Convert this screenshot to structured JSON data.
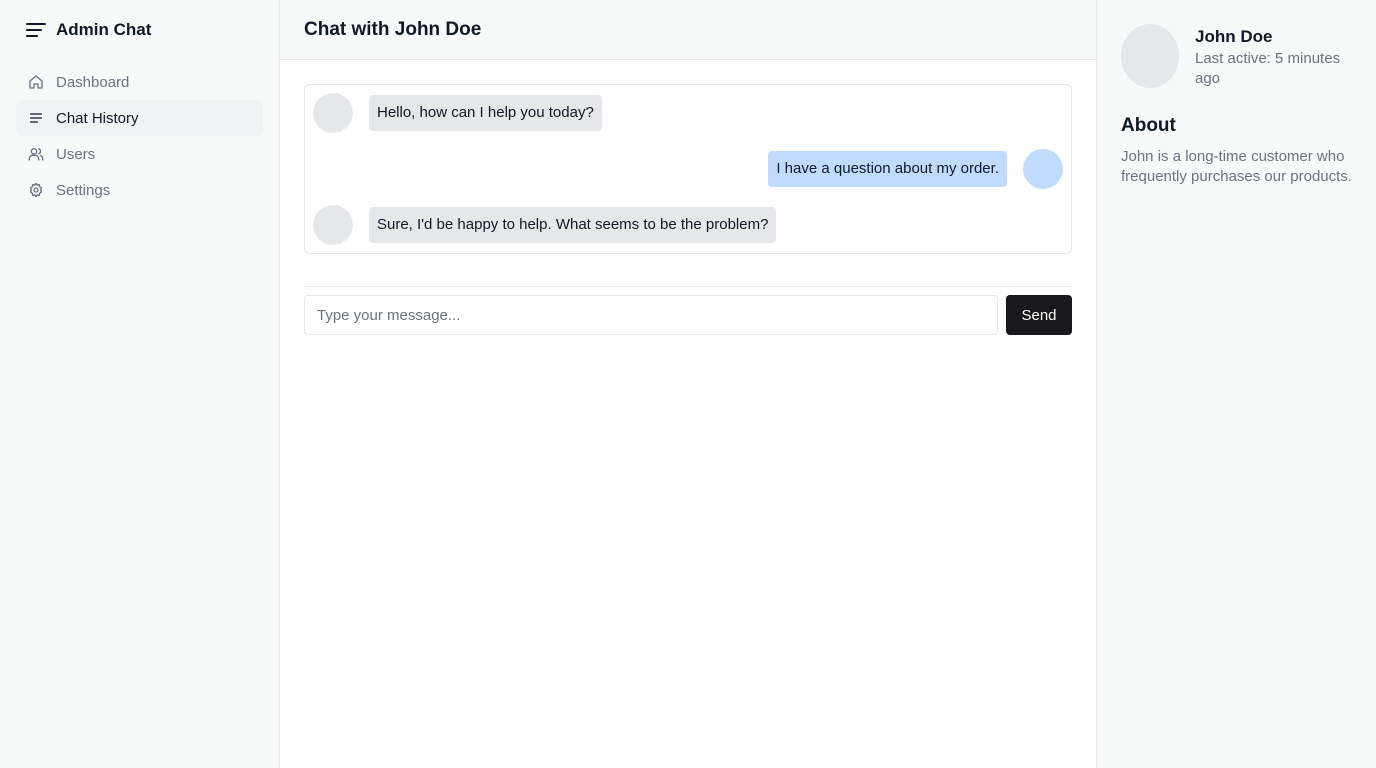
{
  "sidebar": {
    "brand_icon": "menu-icon",
    "brand_title": "Admin Chat",
    "items": [
      {
        "label": "Dashboard",
        "icon": "home-icon",
        "active": false
      },
      {
        "label": "Chat History",
        "icon": "list-icon",
        "active": true
      },
      {
        "label": "Users",
        "icon": "users-icon",
        "active": false
      },
      {
        "label": "Settings",
        "icon": "gear-icon",
        "active": false
      }
    ]
  },
  "main": {
    "title": "Chat with John Doe",
    "messages": [
      {
        "side": "left",
        "text": "Hello, how can I help you today?"
      },
      {
        "side": "right",
        "text": "I have a question about my order."
      },
      {
        "side": "left",
        "text": "Sure, I'd be happy to help. What seems to be the problem?"
      }
    ],
    "composer": {
      "placeholder": "Type your message...",
      "value": "",
      "send_label": "Send"
    }
  },
  "profile": {
    "name": "John Doe",
    "last_active": "Last active: 5 minutes ago",
    "about_title": "About",
    "about_text": "John is a long-time customer who frequently purchases our products."
  },
  "colors": {
    "sidebar_bg": "#f8faf9",
    "active_item_bg": "#f0f2f4",
    "bubble_gray": "#e5e7eb",
    "bubble_blue": "#bfdbfe",
    "send_button_bg": "#18181b",
    "muted_text": "#6b7280",
    "border": "#e5e7eb"
  }
}
